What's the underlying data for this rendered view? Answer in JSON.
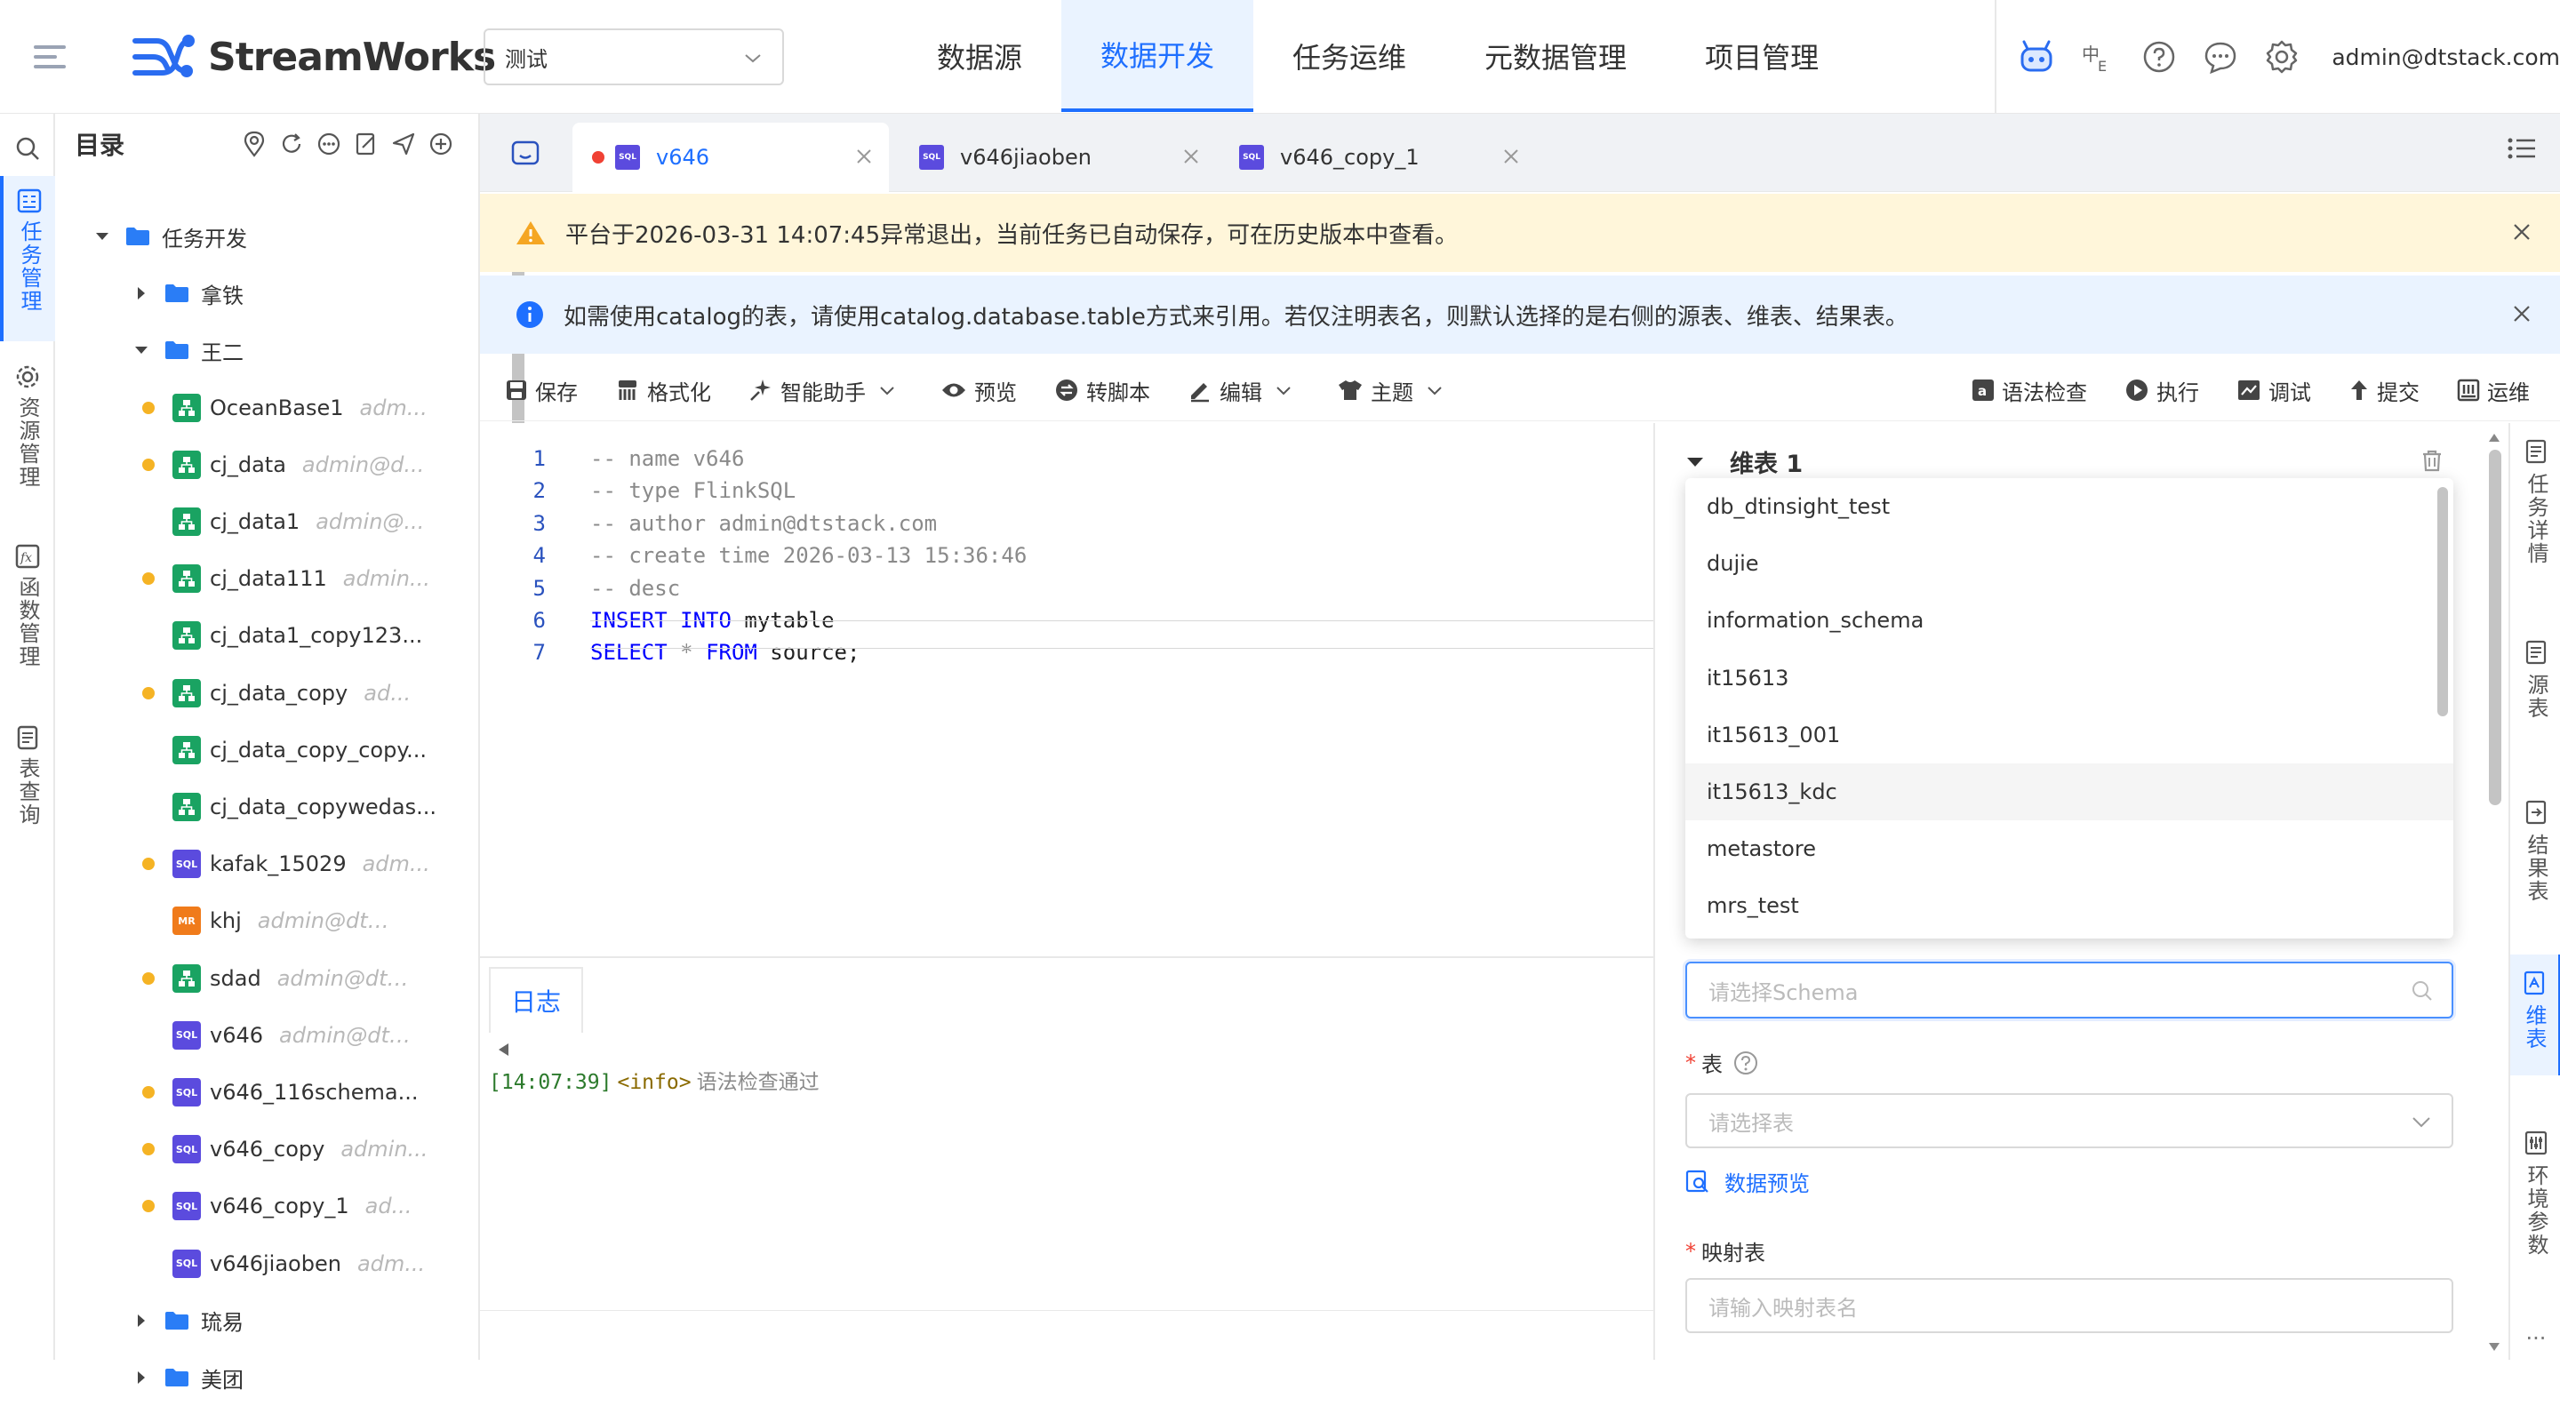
{
  "app": {
    "logo_text": "StreamWorks",
    "project_select": "测试",
    "nav": [
      "数据源",
      "数据开发",
      "任务运维",
      "元数据管理",
      "项目管理"
    ],
    "active_nav": 1,
    "user_email": "admin@dtstack.com",
    "accent_color": "#1e6fff"
  },
  "left_rail": {
    "items": [
      {
        "label": "任务管理",
        "icon": "task-list-icon"
      },
      {
        "label": "资源管理",
        "icon": "resource-gear-icon"
      },
      {
        "label": "函数管理",
        "icon": "function-icon"
      },
      {
        "label": "表查询",
        "icon": "table-query-icon"
      }
    ],
    "active": 0
  },
  "tree": {
    "title": "目录",
    "rows": [
      {
        "type": "folder",
        "name": "任务开发",
        "expanded": true
      },
      {
        "type": "folder",
        "name": "拿铁",
        "expanded": false
      },
      {
        "type": "folder",
        "name": "王二",
        "expanded": true
      },
      {
        "type": "flow",
        "name": "OceanBase1",
        "owner": "adm...",
        "modified": true
      },
      {
        "type": "flow",
        "name": "cj_data",
        "owner": "admin@d...",
        "modified": true
      },
      {
        "type": "flow",
        "name": "cj_data1",
        "owner": "admin@...",
        "modified": false
      },
      {
        "type": "flow",
        "name": "cj_data111",
        "owner": "admin...",
        "modified": true
      },
      {
        "type": "flow",
        "name": "cj_data1_copy123...",
        "owner": "",
        "modified": false
      },
      {
        "type": "flow",
        "name": "cj_data_copy",
        "owner": "ad...",
        "modified": true
      },
      {
        "type": "flow",
        "name": "cj_data_copy_copy...",
        "owner": "",
        "modified": false
      },
      {
        "type": "flow",
        "name": "cj_data_copywedas...",
        "owner": "",
        "modified": false
      },
      {
        "type": "sql",
        "name": "kafak_15029",
        "owner": "adm...",
        "modified": true
      },
      {
        "type": "mr",
        "name": "khj",
        "owner": "admin@dtsta...",
        "modified": false
      },
      {
        "type": "flow",
        "name": "sdad",
        "owner": "admin@dtst...",
        "modified": true
      },
      {
        "type": "sql",
        "name": "v646",
        "owner": "admin@dtst...",
        "modified": false
      },
      {
        "type": "sql",
        "name": "v646_116schema...",
        "owner": "",
        "modified": true
      },
      {
        "type": "sql",
        "name": "v646_copy",
        "owner": "admin...",
        "modified": true
      },
      {
        "type": "sql",
        "name": "v646_copy_1",
        "owner": "ad...",
        "modified": true
      },
      {
        "type": "sql",
        "name": "v646jiaoben",
        "owner": "adm...",
        "modified": false
      },
      {
        "type": "folder",
        "name": "琉易",
        "expanded": false
      },
      {
        "type": "folder",
        "name": "美团",
        "expanded": false
      }
    ]
  },
  "tabs": [
    {
      "label": "v646",
      "badge": "SQL",
      "active": true,
      "unsaved": true
    },
    {
      "label": "v646jiaoben",
      "badge": "SQL",
      "active": false,
      "unsaved": false
    },
    {
      "label": "v646_copy_1",
      "badge": "SQL",
      "active": false,
      "unsaved": false
    }
  ],
  "banners": {
    "warning": "平台于2026-03-31 14:07:45异常退出，当前任务已自动保存，可在历史版本中查看。",
    "info": "如需使用catalog的表，请使用catalog.database.table方式来引用。若仅注明表名，则默认选择的是右侧的源表、维表、结果表。"
  },
  "toolbar": {
    "left": [
      {
        "label": "保存",
        "icon": "save-icon"
      },
      {
        "label": "格式化",
        "icon": "format-icon"
      },
      {
        "label": "智能助手",
        "icon": "sparkle-icon",
        "dropdown": true
      },
      {
        "label": "预览",
        "icon": "eye-icon"
      },
      {
        "label": "转脚本",
        "icon": "convert-icon"
      },
      {
        "label": "编辑",
        "icon": "edit-icon",
        "dropdown": true
      },
      {
        "label": "主题",
        "icon": "theme-icon",
        "dropdown": true
      }
    ],
    "right": [
      {
        "label": "语法检查",
        "icon": "syntax-check-icon"
      },
      {
        "label": "执行",
        "icon": "play-icon"
      },
      {
        "label": "调试",
        "icon": "debug-icon"
      },
      {
        "label": "提交",
        "icon": "submit-icon"
      },
      {
        "label": "运维",
        "icon": "ops-icon"
      }
    ]
  },
  "editor": {
    "lines": [
      {
        "n": "1",
        "parts": [
          {
            "c": "cm",
            "t": "-- name v646"
          }
        ]
      },
      {
        "n": "2",
        "parts": [
          {
            "c": "cm",
            "t": "-- type FlinkSQL"
          }
        ]
      },
      {
        "n": "3",
        "parts": [
          {
            "c": "cm",
            "t": "-- author admin@dtstack.com"
          }
        ]
      },
      {
        "n": "4",
        "parts": [
          {
            "c": "cm",
            "t": "-- create time 2026-03-13 15:36:46"
          }
        ]
      },
      {
        "n": "5",
        "parts": [
          {
            "c": "cm",
            "t": "-- desc"
          }
        ]
      },
      {
        "n": "6",
        "parts": [
          {
            "c": "kw",
            "t": "INSERT INTO"
          },
          {
            "c": "pl",
            "t": " mytable"
          }
        ]
      },
      {
        "n": "7",
        "parts": [
          {
            "c": "kw",
            "t": "SELECT"
          },
          {
            "c": "cm",
            "t": " * "
          },
          {
            "c": "kw",
            "t": "FROM"
          },
          {
            "c": "pl",
            "t": " source;"
          }
        ]
      }
    ]
  },
  "log": {
    "tab_label": "日志",
    "time": "[14:07:39]",
    "level": "<info>",
    "message": "语法检查通过"
  },
  "config": {
    "section_title": "维表 1",
    "schema_options": [
      "db_dtinsight_test",
      "dujie",
      "information_schema",
      "it15613",
      "it15613_001",
      "it15613_kdc",
      "metastore",
      "mrs_test"
    ],
    "hovered_option": 5,
    "schema_placeholder": "请选择Schema",
    "table_label": "表",
    "table_placeholder": "请选择表",
    "preview_link": "数据预览",
    "mapping_label": "映射表",
    "mapping_placeholder": "请输入映射表名"
  },
  "right_rail": {
    "items": [
      "任务详情",
      "源表",
      "结果表",
      "维表",
      "环境参数"
    ],
    "active": 3,
    "more": "..."
  }
}
